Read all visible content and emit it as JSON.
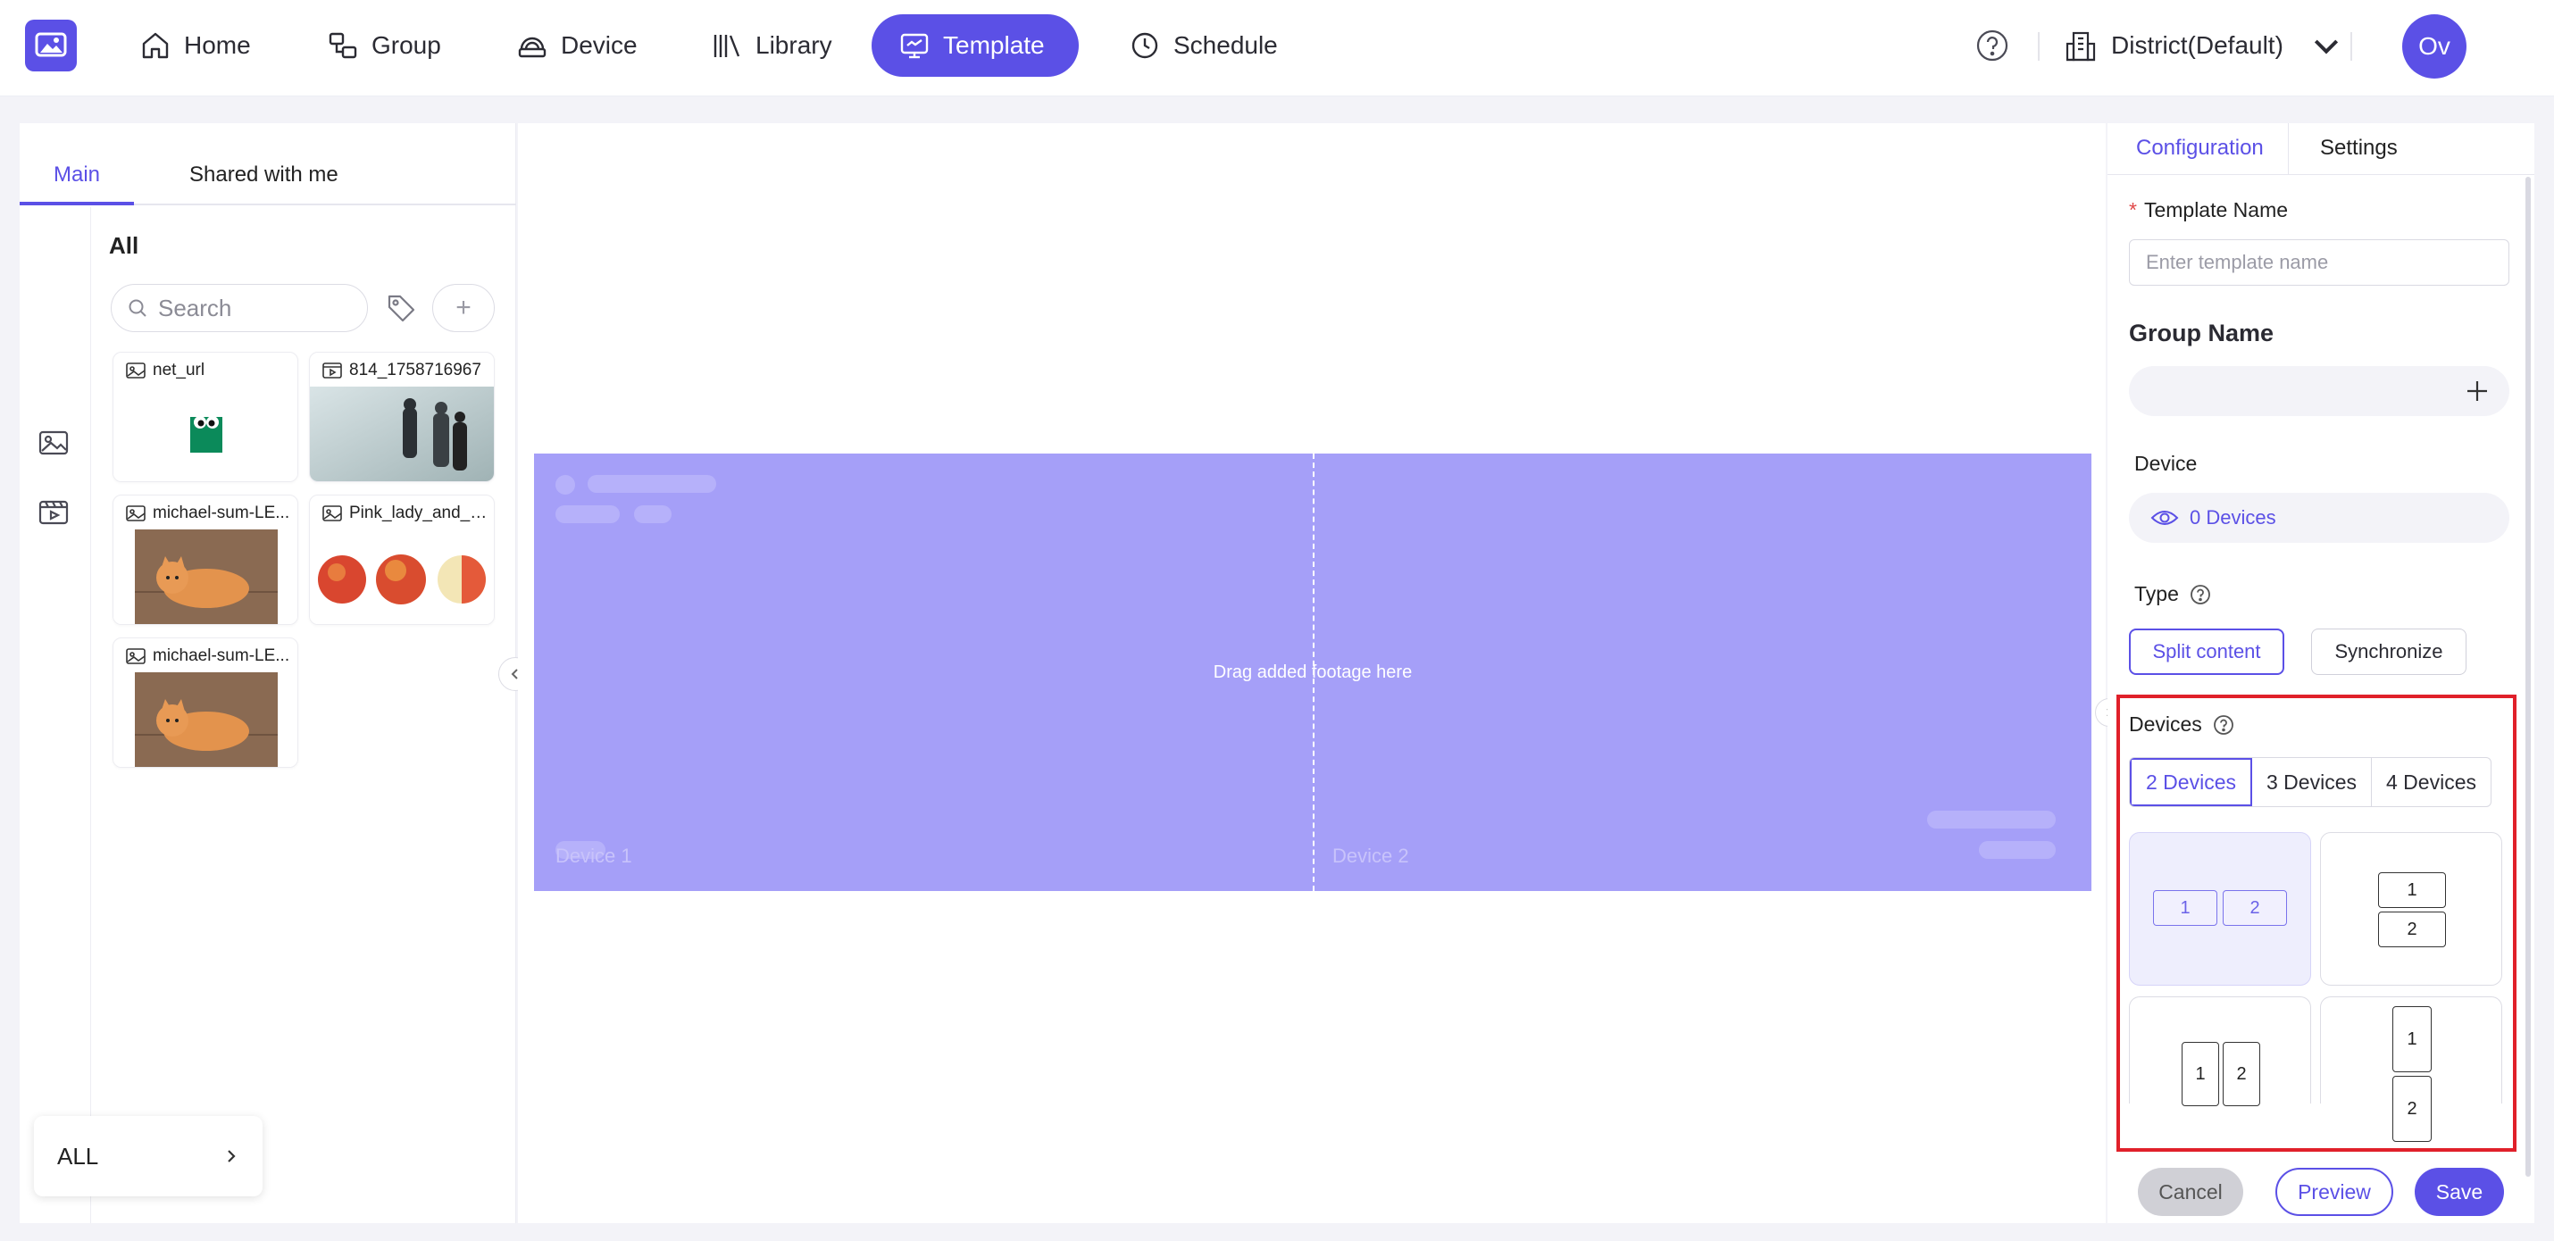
{
  "nav": {
    "items": [
      {
        "label": "Home",
        "icon": "home-icon"
      },
      {
        "label": "Group",
        "icon": "group-icon"
      },
      {
        "label": "Device",
        "icon": "device-icon"
      },
      {
        "label": "Library",
        "icon": "library-icon"
      },
      {
        "label": "Template",
        "icon": "template-icon",
        "active": true
      },
      {
        "label": "Schedule",
        "icon": "clock-icon"
      }
    ],
    "district": "District(Default)",
    "avatar": "Ov"
  },
  "colors": {
    "accent": "#5b50e6",
    "stage": "#a59ff8",
    "highlight": "#e0202a"
  },
  "library": {
    "tabs": [
      "Main",
      "Shared with me"
    ],
    "active_tab": "Main",
    "heading": "All",
    "search_placeholder": "Search",
    "add_symbol": "+",
    "cards": [
      {
        "title": "net_url",
        "type": "image"
      },
      {
        "title": "814_1758716967",
        "type": "video"
      },
      {
        "title": "michael-sum-LE...",
        "type": "image"
      },
      {
        "title": "Pink_lady_and_c...",
        "type": "image"
      },
      {
        "title": "michael-sum-LE...",
        "type": "image"
      }
    ],
    "filter_label": "ALL"
  },
  "canvas": {
    "drag_hint": "Drag added footage here",
    "device_labels": [
      "Device 1",
      "Device 2"
    ]
  },
  "config": {
    "tabs": [
      "Configuration",
      "Settings"
    ],
    "template_name_label": "Template Name",
    "template_name_placeholder": "Enter template name",
    "template_name_value": "",
    "group_name_label": "Group Name",
    "device_label": "Device",
    "device_count": "0 Devices",
    "type_label": "Type",
    "type_options": [
      "Split content",
      "Synchronize"
    ],
    "type_selected": "Split content",
    "devices_label": "Devices",
    "device_count_options": [
      "2 Devices",
      "3 Devices",
      "4 Devices"
    ],
    "device_count_selected": "2 Devices",
    "layouts": [
      {
        "name": "side-by-side",
        "cells": [
          "1",
          "2"
        ]
      },
      {
        "name": "stacked",
        "cells": [
          "1",
          "2"
        ]
      },
      {
        "name": "portrait-side-by-side",
        "cells": [
          "1",
          "2"
        ]
      },
      {
        "name": "portrait-stacked",
        "cells": [
          "1",
          "2"
        ]
      }
    ],
    "buttons": {
      "cancel": "Cancel",
      "preview": "Preview",
      "save": "Save"
    }
  }
}
